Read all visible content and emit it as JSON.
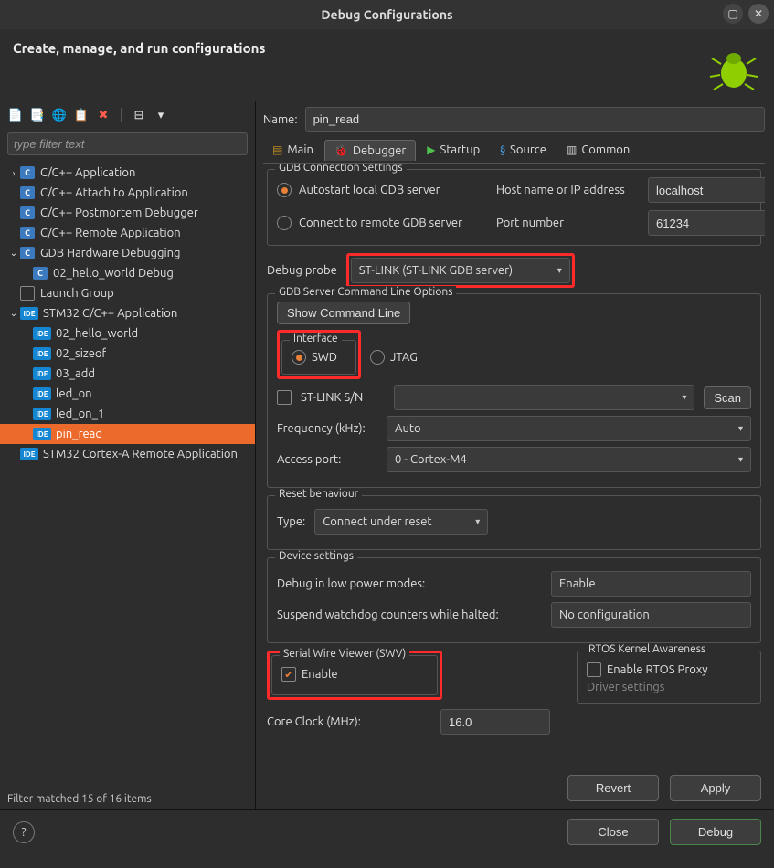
{
  "window": {
    "title": "Debug Configurations"
  },
  "header": {
    "title": "Create, manage, and run configurations"
  },
  "filter": {
    "placeholder": "type filter text",
    "status": "Filter matched 15 of 16 items"
  },
  "tree": {
    "items": [
      {
        "label": "C/C++ Application",
        "kind": "c",
        "expand": "closed"
      },
      {
        "label": "C/C++ Attach to Application",
        "kind": "c"
      },
      {
        "label": "C/C++ Postmortem Debugger",
        "kind": "c"
      },
      {
        "label": "C/C++ Remote Application",
        "kind": "c"
      },
      {
        "label": "GDB Hardware Debugging",
        "kind": "c",
        "expand": "open"
      },
      {
        "label": "02_hello_world Debug",
        "kind": "c",
        "indent": 1
      },
      {
        "label": "Launch Group",
        "kind": "launch"
      },
      {
        "label": "STM32 C/C++ Application",
        "kind": "ide",
        "expand": "open"
      },
      {
        "label": "02_hello_world",
        "kind": "ide",
        "indent": 1
      },
      {
        "label": "02_sizeof",
        "kind": "ide",
        "indent": 1
      },
      {
        "label": "03_add",
        "kind": "ide",
        "indent": 1
      },
      {
        "label": "led_on",
        "kind": "ide",
        "indent": 1
      },
      {
        "label": "led_on_1",
        "kind": "ide",
        "indent": 1
      },
      {
        "label": "pin_read",
        "kind": "ide",
        "indent": 1,
        "selected": true
      },
      {
        "label": "STM32 Cortex-A Remote Application",
        "kind": "ide"
      }
    ]
  },
  "config": {
    "name_label": "Name:",
    "name_value": "pin_read",
    "tabs": {
      "main": "Main",
      "debugger": "Debugger",
      "startup": "Startup",
      "source": "Source",
      "common": "Common"
    },
    "gdb_conn": {
      "legend": "GDB Connection Settings",
      "autostart": "Autostart local GDB server",
      "connect_remote": "Connect to remote GDB server",
      "host_label": "Host name or IP address",
      "host_value": "localhost",
      "port_label": "Port number",
      "port_value": "61234"
    },
    "debug_probe": {
      "label": "Debug probe",
      "value": "ST-LINK (ST-LINK GDB server)"
    },
    "gdb_cmd": {
      "legend": "GDB Server Command Line Options",
      "show_cmd": "Show Command Line",
      "interface": {
        "legend": "Interface",
        "swd": "SWD",
        "jtag": "JTAG"
      },
      "stlink_sn": "ST-LINK S/N",
      "scan": "Scan",
      "freq_label": "Frequency (kHz):",
      "freq_value": "Auto",
      "access_label": "Access port:",
      "access_value": "0 - Cortex-M4"
    },
    "reset": {
      "legend": "Reset behaviour",
      "type_label": "Type:",
      "type_value": "Connect under reset"
    },
    "device": {
      "legend": "Device settings",
      "low_power_label": "Debug in low power modes:",
      "low_power_value": "Enable",
      "wdog_label": "Suspend watchdog counters while halted:",
      "wdog_value": "No configuration"
    },
    "swv": {
      "legend": "Serial Wire Viewer (SWV)",
      "enable": "Enable",
      "core_label": "Core Clock (MHz):",
      "core_value": "16.0"
    },
    "rtos": {
      "legend": "RTOS Kernel Awareness",
      "enable": "Enable RTOS Proxy",
      "driver": "Driver settings"
    },
    "buttons": {
      "revert": "Revert",
      "apply": "Apply"
    }
  },
  "footer": {
    "close": "Close",
    "debug": "Debug"
  }
}
